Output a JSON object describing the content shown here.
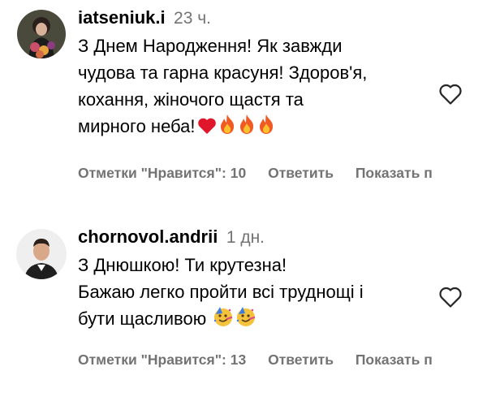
{
  "comments": [
    {
      "username": "iatseniuk.i",
      "time": "23 ч.",
      "text": "З Днем Народження! Як завжди\nчудова та гарна красуня! Здоров'я,\nкохання, жіночого щастя та\nмирного неба!",
      "emoji": [
        "red-heart-emoji",
        "fire-emoji",
        "fire-emoji",
        "fire-emoji"
      ],
      "likes_label": "Отметки \"Нравится\": 10",
      "reply_label": "Ответить",
      "show_label": "Показать п"
    },
    {
      "username": "chornovol.andrii",
      "time": "1 дн.",
      "text": "З Днюшкою! Ти крутезна!\nБажаю легко пройти всі труднощі і\nбути щасливою",
      "emoji": [
        "partying-face-emoji",
        "partying-face-emoji"
      ],
      "likes_label": "Отметки \"Нравится\": 13",
      "reply_label": "Ответить",
      "show_label": "Показать п"
    }
  ]
}
